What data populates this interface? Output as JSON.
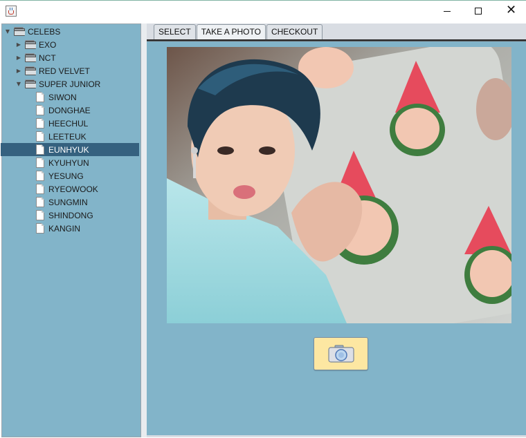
{
  "window": {
    "title": "",
    "minimize_glyph": "",
    "maximize_glyph": "",
    "close_glyph": "✕",
    "accent_color": "#82b4c9",
    "selection_color": "#35617f"
  },
  "tree": {
    "root": "CELEBS",
    "groups": [
      {
        "label": "EXO",
        "expanded": false
      },
      {
        "label": "NCT",
        "expanded": false
      },
      {
        "label": "RED VELVET",
        "expanded": false
      },
      {
        "label": "SUPER JUNIOR",
        "expanded": true
      }
    ],
    "members": [
      "SIWON",
      "DONGHAE",
      "HEECHUL",
      "LEETEUK",
      "EUNHYUK",
      "KYUHYUN",
      "YESUNG",
      "RYEOWOOK",
      "SUNGMIN",
      "SHINDONG",
      "KANGIN"
    ],
    "selected": "EUNHYUK"
  },
  "tabs": {
    "items": [
      "SELECT",
      "TAKE A PHOTO",
      "CHECKOUT"
    ],
    "active": "TAKE A PHOTO"
  },
  "photo_area": {
    "icon": "camera-icon",
    "button_color": "#fde7a2"
  }
}
